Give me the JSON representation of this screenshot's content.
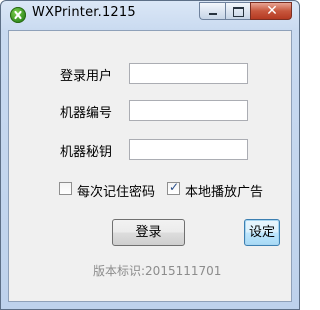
{
  "window": {
    "title": "WXPrinter.1215",
    "close_glyph": "✕"
  },
  "form": {
    "user_label": "登录用户",
    "user_value": "",
    "machine_id_label": "机器编号",
    "machine_id_value": "",
    "machine_key_label": "机器秘钥",
    "machine_key_value": ""
  },
  "options": {
    "remember_password_label": "每次记住密码",
    "remember_password_checked": false,
    "local_broadcast_label": "本地播放广告",
    "local_broadcast_checked": true,
    "check_glyph": "✓"
  },
  "buttons": {
    "login_label": "登录",
    "settings_label": "设定"
  },
  "footer": {
    "version_text": "版本标识:2015111701"
  },
  "icons": {
    "app": "app-logo-icon",
    "minimize": "minimize-icon",
    "maximize": "maximize-icon",
    "close": "close-icon"
  },
  "colors": {
    "close_button": "#c7573d",
    "default_button_border": "#3c7fb1",
    "version_text": "#8c8c8c"
  }
}
